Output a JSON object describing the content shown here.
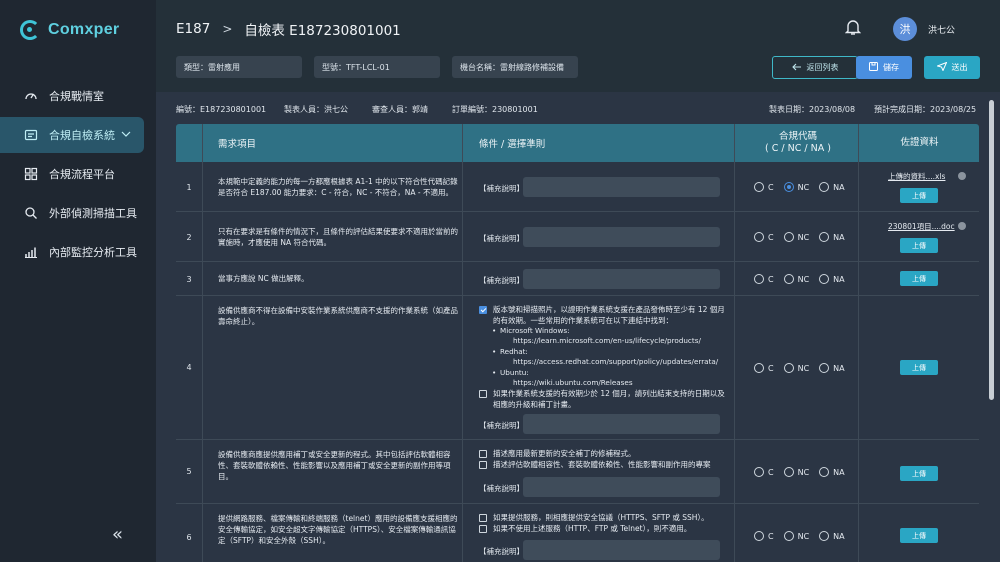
{
  "app": {
    "name": "Comxper"
  },
  "sidebar": {
    "items": [
      {
        "label": "合規戰情室",
        "icon": "gauge-icon"
      },
      {
        "label": "合規自檢系統",
        "icon": "list-icon",
        "active": true
      },
      {
        "label": "合規流程平台",
        "icon": "grid-icon"
      },
      {
        "label": "外部偵測掃描工具",
        "icon": "search-icon"
      },
      {
        "label": "內部監控分析工具",
        "icon": "bar-chart-icon"
      }
    ],
    "collapse_label": "«"
  },
  "header": {
    "breadcrumb_root": "E187",
    "breadcrumb_sep": ">",
    "breadcrumb_current": "自檢表 E187230801001",
    "avatar": "洪",
    "username": "洪七公"
  },
  "filters": {
    "type": "類型：雷射應用",
    "model": "型號：TFT-LCL-01",
    "machine": "機台名稱：雷射線路修補設備"
  },
  "buttons": {
    "back": "返回列表",
    "save": "儲存",
    "send": "送出"
  },
  "meta": {
    "code": "編號：E187230801001",
    "creator": "製表人員：洪七公",
    "reviewer": "審查人員：郭靖",
    "order": "訂單編號：230801001",
    "created": "製表日期：2023/08/08",
    "due": "預計完成日期：2023/08/25"
  },
  "table": {
    "headers": {
      "req": "需求項目",
      "cond": "條件 / 選擇準則",
      "code_line1": "合規代碼",
      "code_line2": "( C / NC / NA )",
      "evidence": "佐證資料"
    },
    "supplement_label": "【補充說明】",
    "upload_label": "上傳",
    "radio_labels": [
      "C",
      "NC",
      "NA"
    ],
    "rows": [
      {
        "num": "1",
        "req": "本規範中定義的能力的每一方都應根據表 A1-1 中的以下符合性代碼記錄是否符合 E187.00 能力要求：C - 符合，NC - 不符合，NA - 不適用。",
        "selected": "NC",
        "file": "上傳的資料....xls"
      },
      {
        "num": "2",
        "req": "只有在要求是有條件的情況下，且條件的評估結果使要求不適用於當前的實施時，才應使用 NA 符合代碼。",
        "selected": "",
        "file": "230801項目....doc"
      },
      {
        "num": "3",
        "req": "當事方應說 NC 做出解釋。",
        "selected": ""
      },
      {
        "num": "4",
        "req": "設備供應商不得在設備中安裝作業系統供應商不支援的作業系統（如產品壽命終止）。",
        "selected": "",
        "checks": [
          {
            "checked": true,
            "lines": [
              "版本號和掃描照片，以證明作業系統支援在產品發佈時至少有 12 個月",
              "的有效期。一些常用的作業系統可在以下連結中找到："
            ]
          },
          {
            "checked": false,
            "lines": [
              "如果作業系統支援的有效期少於 12 個月，請列出結束支持的日期以及",
              "相應的升級和補丁計畫。"
            ]
          }
        ],
        "bullets": [
          {
            "name": "Microsoft Windows:",
            "url": "https://learn.microsoft.com/en-us/lifecycle/products/"
          },
          {
            "name": "Redhat:",
            "url": "https://access.redhat.com/support/policy/updates/errata/"
          },
          {
            "name": "Ubuntu:",
            "url": "https://wiki.ubuntu.com/Releases"
          }
        ]
      },
      {
        "num": "5",
        "req": "設備供應商應提供應用補丁或安全更新的程式。其中包括評估軟體相容性、套裝軟體依賴性、性能影響以及應用補丁或安全更新的副作用等項目。",
        "selected": "",
        "checks": [
          {
            "checked": false,
            "lines": [
              "描述應用最新更新的安全補丁的修補程式。"
            ]
          },
          {
            "checked": false,
            "lines": [
              "描述評估軟體相容性、套裝軟體依賴性、性能影響和副作用的專案"
            ]
          }
        ]
      },
      {
        "num": "6",
        "req": "提供網路服務、檔案傳輸和終端服務（telnet）應用的設備應支援相應的安全傳輸協定，如安全超文字傳輸協定（HTTPS）、安全檔案傳輸通訊協定（SFTP）和安全外殼（SSH）。",
        "selected": "",
        "checks": [
          {
            "checked": false,
            "lines": [
              "如果提供服務，則相應提供安全協議（HTTPS、SFTP 或 SSH）。"
            ]
          },
          {
            "checked": false,
            "lines": [
              "如果不使用上述服務（HTTP、FTP 或 Telnet），則不適用。"
            ]
          }
        ]
      }
    ]
  },
  "colors": {
    "accent": "#3fc5d8",
    "primary": "#4a8fe0",
    "teal": "#2aa6c4",
    "header_row": "#2f7185"
  }
}
